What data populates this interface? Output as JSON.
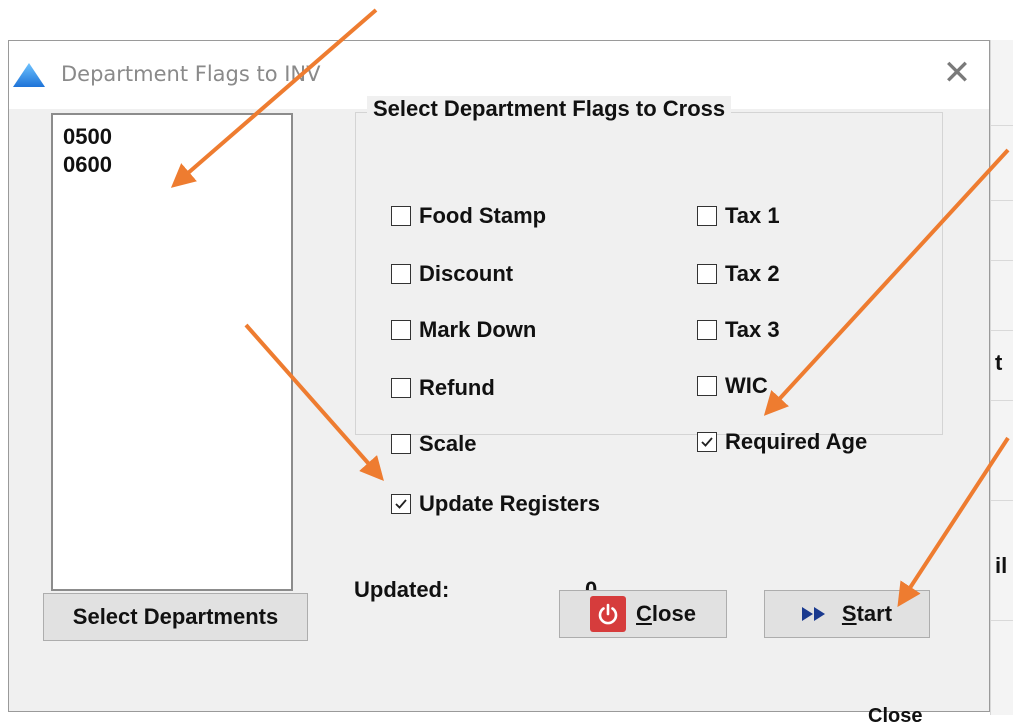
{
  "window": {
    "title": "Department Flags to INV",
    "close_symbol": "✕",
    "icon": "app-triangle-icon"
  },
  "departments_list": {
    "items": [
      "0500",
      "0600"
    ]
  },
  "select_departments_button": "Select Departments",
  "flags_group": {
    "legend": "Select Department Flags to Cross",
    "left_column": [
      {
        "label": "Food Stamp",
        "checked": false
      },
      {
        "label": "Discount",
        "checked": false
      },
      {
        "label": "Mark Down",
        "checked": false
      },
      {
        "label": "Refund",
        "checked": false
      },
      {
        "label": "Scale",
        "checked": false
      }
    ],
    "right_column": [
      {
        "label": "Tax 1",
        "checked": false
      },
      {
        "label": "Tax 2",
        "checked": false
      },
      {
        "label": "Tax 3",
        "checked": false
      },
      {
        "label": "WIC",
        "checked": false
      },
      {
        "label": "Required Age",
        "checked": true
      }
    ]
  },
  "update_registers": {
    "label": "Update Registers",
    "checked": true
  },
  "status": {
    "updated_label": "Updated:",
    "updated_value": "0"
  },
  "buttons": {
    "close": {
      "mnemonic": "C",
      "rest": "lose",
      "icon": "power-icon"
    },
    "start": {
      "mnemonic": "S",
      "rest": "tart",
      "icon": "fast-forward-icon"
    }
  },
  "background_fragments": [
    "t",
    "il",
    "Close"
  ],
  "colors": {
    "annotation_arrow": "#ee7c30",
    "power_icon": "#d63c3c",
    "start_icon": "#1a3a8f"
  }
}
